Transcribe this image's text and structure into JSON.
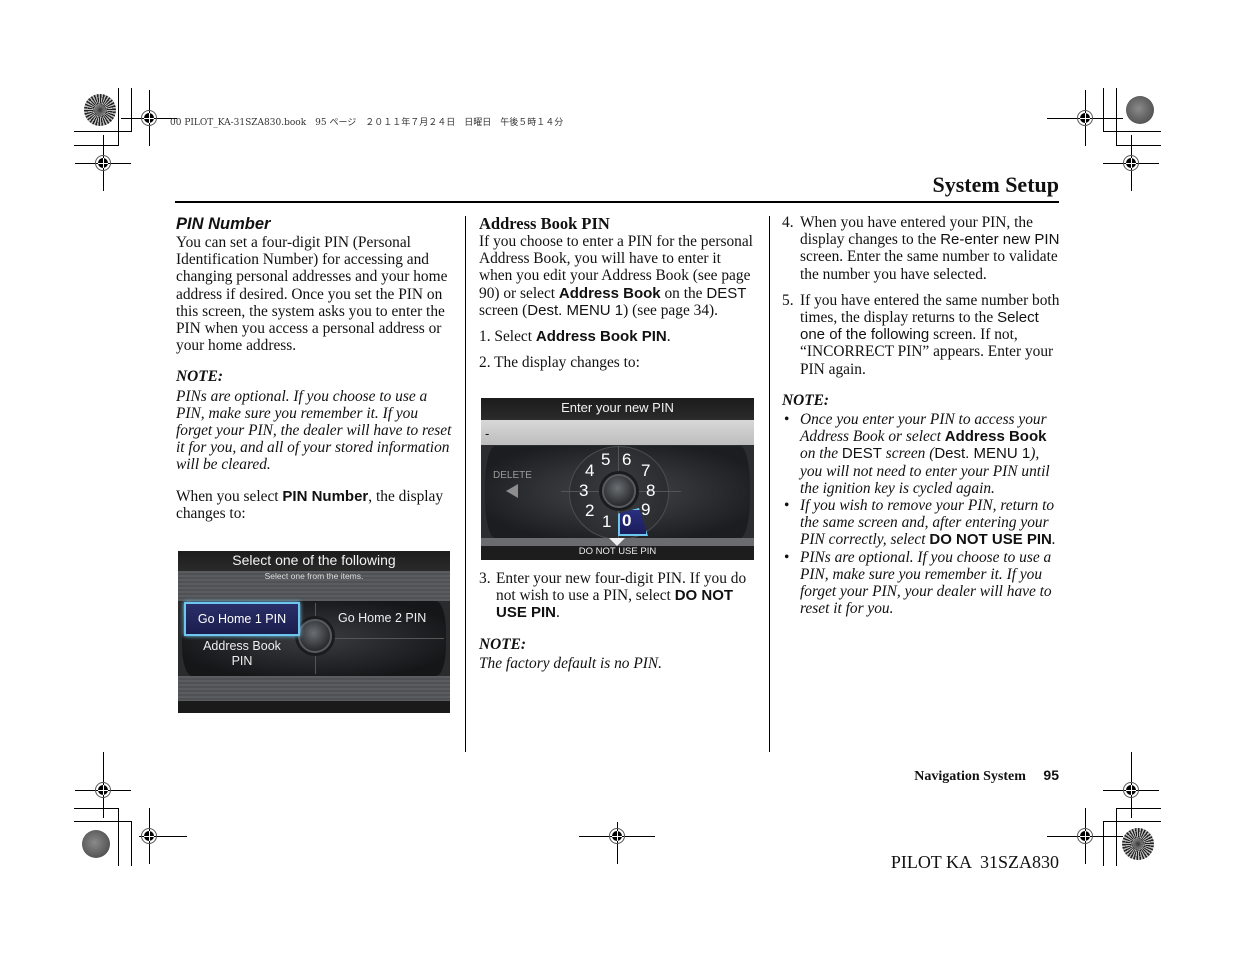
{
  "print_header": {
    "file_info": "00 PILOT_KA-31SZA830.book　95 ページ　２０１１年７月２４日　日曜日　午後５時１４分"
  },
  "page": {
    "section_title": "System Setup",
    "footer_label": "Navigation System",
    "page_number": "95",
    "model_code": "PILOT KA  31SZA830"
  },
  "col1": {
    "heading": "PIN Number",
    "intro": "You can set a four-digit PIN (Personal Identification Number) for accessing and changing personal addresses and your home address if desired. Once you set the PIN on this screen, the system asks you to enter the PIN when you access a personal address or your home address.",
    "note_label": "NOTE:",
    "note_text": "PINs are optional. If you choose to use a PIN, make sure you remember it. If you forget your PIN, the dealer will have to reset it for you, and all of your stored information will be cleared.",
    "select_pre": "When you select ",
    "select_bold": "PIN Number",
    "select_post": ", the display changes to:",
    "screen": {
      "title": "Select one of the following",
      "subtitle": "Select one from the items.",
      "options": [
        "Go Home 1 PIN",
        "Go Home 2 PIN",
        "Address Book",
        "PIN"
      ],
      "selected": "Go Home 1 PIN"
    }
  },
  "col2": {
    "heading": "Address Book PIN",
    "p1_a": "If you choose to enter a PIN for the personal Address Book, you will have to enter it when you edit your Address Book (see page 90) or select ",
    "p1_bold": "Address Book",
    "p1_b": " on the ",
    "p1_dest": "DEST",
    "p1_c": " screen (",
    "p1_menu": "Dest. MENU 1",
    "p1_d": ") (see page 34).",
    "step1_num": "1.",
    "step1_pre": "Select ",
    "step1_bold": "Address Book PIN",
    "step1_post": ".",
    "step2_num": "2.",
    "step2": "The display changes to:",
    "screen": {
      "title": "Enter your new PIN",
      "entry_value": "-",
      "delete_label": "DELETE",
      "dial_digits": [
        "5",
        "6",
        "4",
        "7",
        "3",
        "8",
        "2",
        "9",
        "1",
        "0"
      ],
      "selected_digit": "0",
      "bottom_label": "DO NOT USE PIN"
    },
    "step3_num": "3.",
    "step3_pre": "Enter your new four-digit PIN. If you do not wish to use a PIN, select ",
    "step3_bold": "DO NOT USE PIN",
    "step3_post": ".",
    "note_label": "NOTE:",
    "note_text": "The factory default is no PIN."
  },
  "col3": {
    "step4_num": "4.",
    "step4_a": "When you have entered your PIN, the display changes to the ",
    "step4_sans": "Re-enter new PIN",
    "step4_b": " screen. Enter the same number to validate the number you have selected.",
    "step5_num": "5.",
    "step5_a": "If you have entered the same number both times, the display returns to the ",
    "step5_sans": "Select one of the following",
    "step5_b": " screen. If not, “INCORRECT PIN” appears. Enter your PIN again.",
    "note_label": "NOTE:",
    "bullet": "•",
    "b1_a": "Once you enter your PIN to access your Address Book or select ",
    "b1_bold": "Address Book",
    "b1_b": " on the ",
    "b1_dest": "DEST",
    "b1_c": " screen (",
    "b1_menu": "Dest. MENU 1",
    "b1_d": "), you will not need to enter your PIN until the ignition key is cycled again.",
    "b2_a": "If you wish to remove your PIN, return to the same screen and, after entering your PIN correctly, select ",
    "b2_bold": "DO NOT USE PIN",
    "b2_b": ".",
    "b3": "PINs are optional. If you choose to use a PIN, make sure you remember it. If you forget your PIN, your dealer will have to reset it for you."
  }
}
